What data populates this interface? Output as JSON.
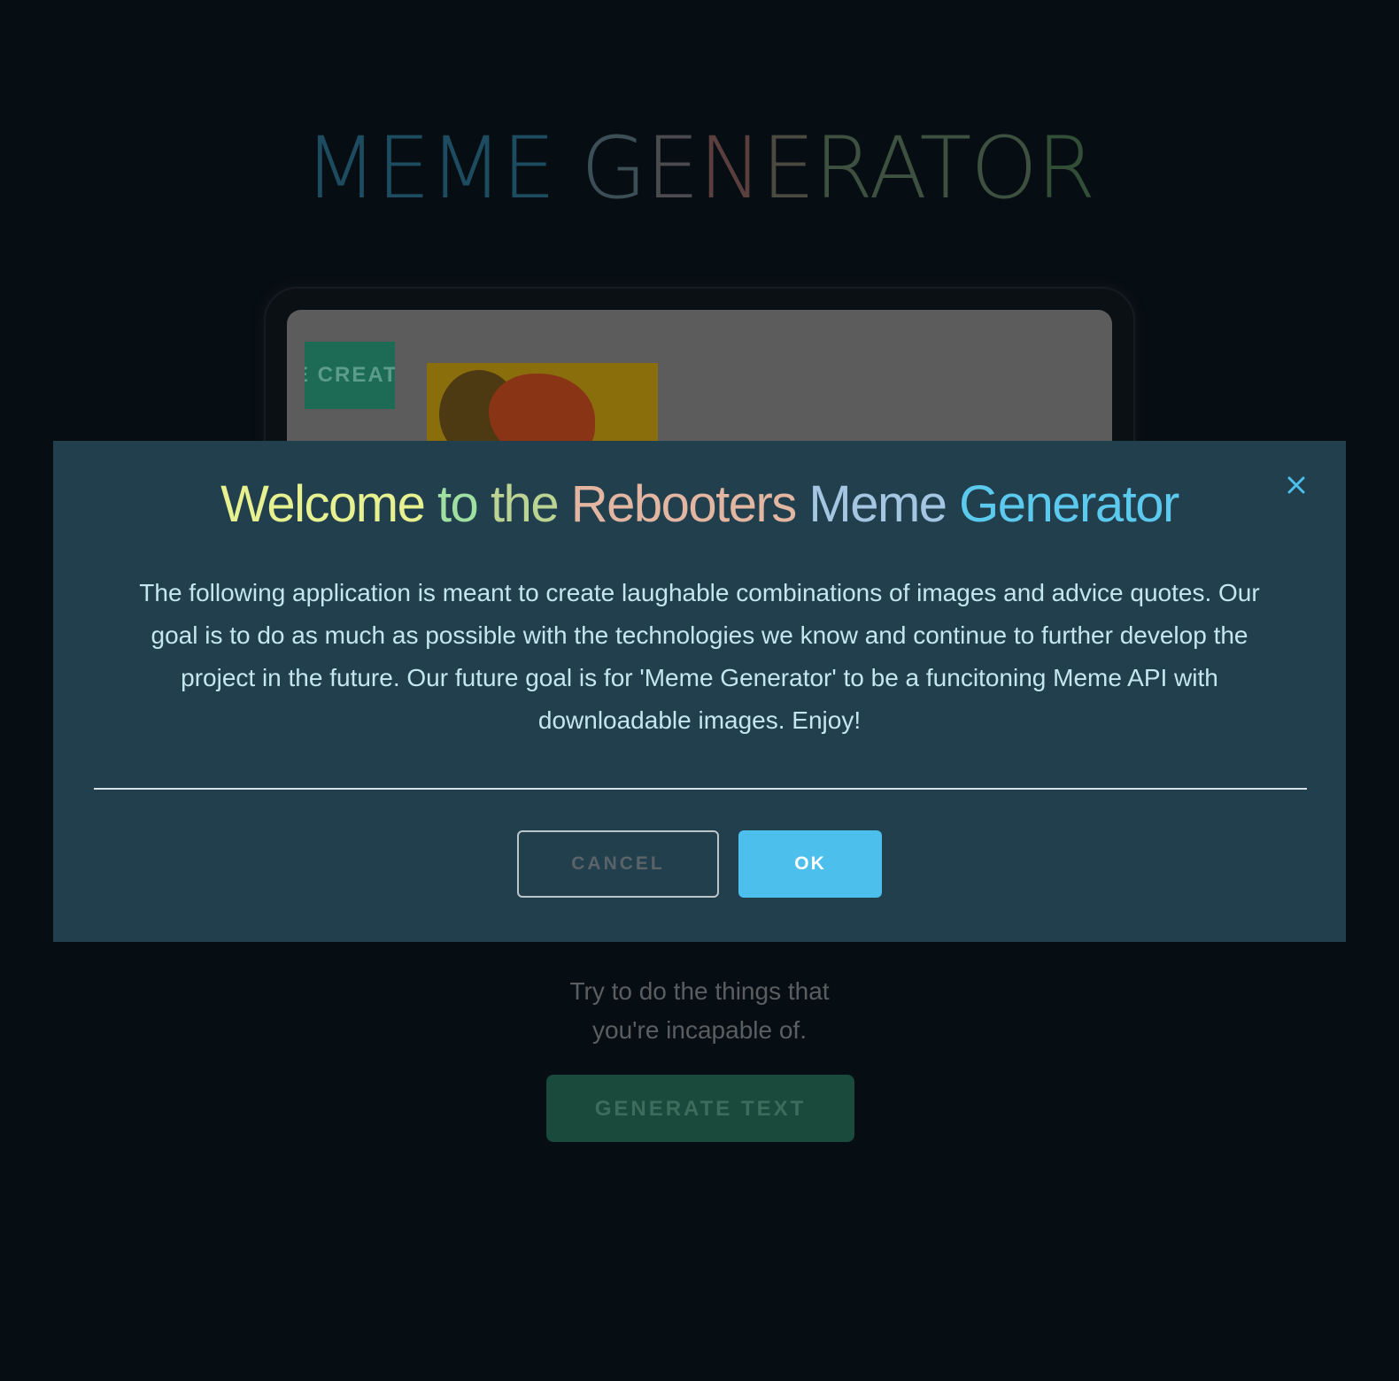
{
  "app": {
    "title_word1": "MEME",
    "title_word2_parts": [
      "G",
      "E",
      "N",
      "E",
      "RATO",
      "R"
    ],
    "create_button_label": "E CREATE",
    "quote_line1": "Try to do the things that",
    "quote_line2": "you're incapable of.",
    "generate_button_label": "GENERATE TEXT"
  },
  "modal": {
    "title_parts": [
      "Welcome",
      " to",
      " the",
      " Rebooters",
      " Meme",
      " Generator"
    ],
    "body": "The following application is meant to create laughable combinations of images and advice quotes. Our goal is to do as much as possible with the technologies we know and continue to further develop the project in the future. Our future goal is for 'Meme Generator' to be a funcitoning Meme API with downloadable images. Enjoy!",
    "cancel_label": "CANCEL",
    "ok_label": "OK",
    "close_icon": "close-icon"
  },
  "colors": {
    "background": "#070e13",
    "modal_bg": "#223f4d",
    "ok_button": "#4dbfed",
    "create_button": "#1d6a55",
    "generate_button": "#1a4a3c",
    "close_icon": "#4dbfed"
  }
}
